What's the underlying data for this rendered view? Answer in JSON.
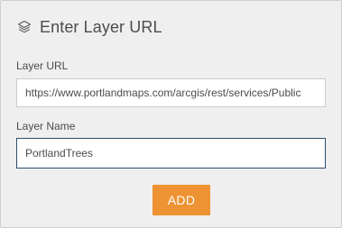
{
  "dialog": {
    "title": "Enter Layer URL",
    "icon": "layers-icon"
  },
  "form": {
    "url_label": "Layer URL",
    "url_value": "https://www.portlandmaps.com/arcgis/rest/services/Public",
    "name_label": "Layer Name",
    "name_value": "PortlandTrees",
    "add_label": "ADD"
  },
  "colors": {
    "panel_background": "#efefef",
    "accent": "#ee9333",
    "focus_border": "#2e4d6b",
    "text": "#4c4c4c"
  }
}
